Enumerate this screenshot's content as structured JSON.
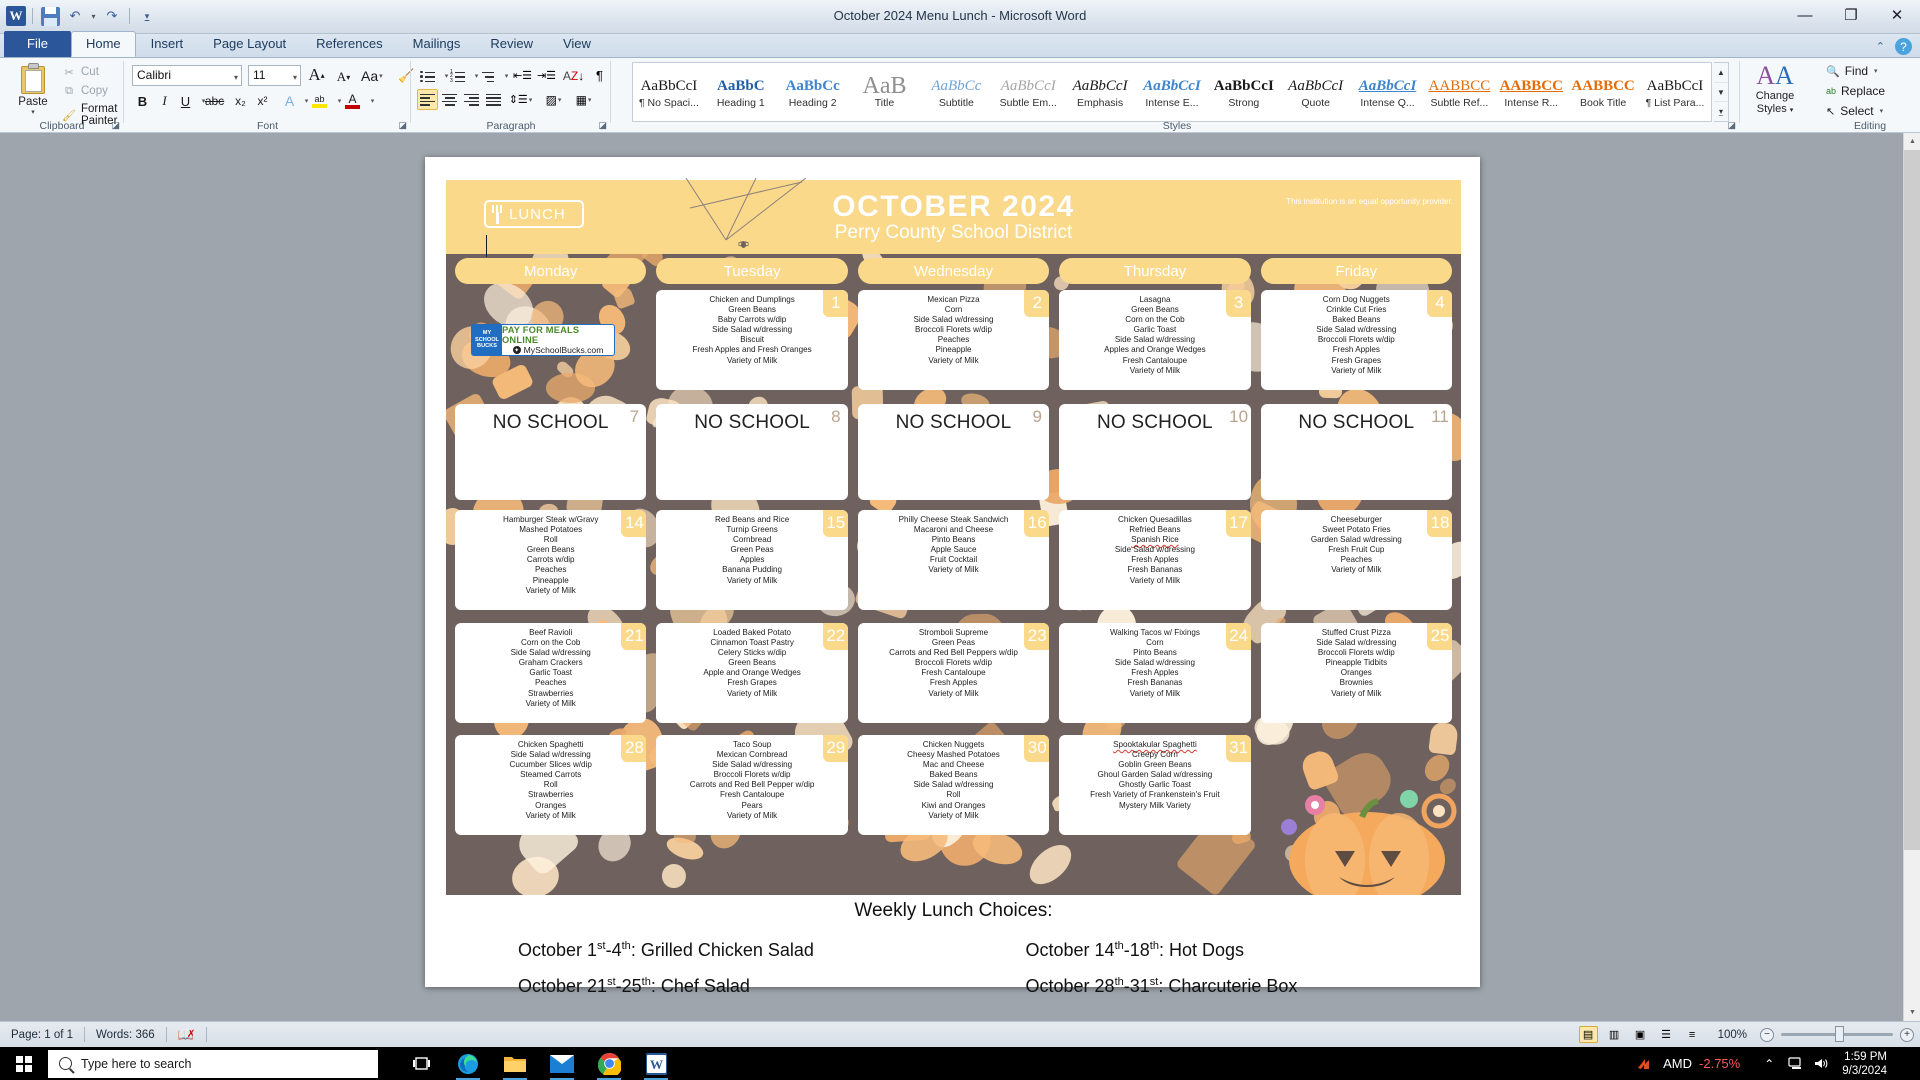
{
  "window": {
    "title": "October 2024 Menu Lunch  -  Microsoft Word",
    "minimize": "—",
    "restore": "❐",
    "close": "✕",
    "ribbon_collapse": "⌃",
    "help": "?"
  },
  "qat": {
    "word_logo": "W",
    "save": "save-icon",
    "undo": "↶",
    "redo": "↷",
    "customize": "☰"
  },
  "tabs": [
    {
      "label": "File",
      "active": false,
      "file": true
    },
    {
      "label": "Home",
      "active": true
    },
    {
      "label": "Insert",
      "active": false
    },
    {
      "label": "Page Layout",
      "active": false
    },
    {
      "label": "References",
      "active": false
    },
    {
      "label": "Mailings",
      "active": false
    },
    {
      "label": "Review",
      "active": false
    },
    {
      "label": "View",
      "active": false
    }
  ],
  "ribbon": {
    "clipboard": {
      "group_label": "Clipboard",
      "paste": "Paste",
      "cut": "Cut",
      "copy": "Copy",
      "format_painter": "Format Painter"
    },
    "font": {
      "group_label": "Font",
      "font_name": "Calibri",
      "font_size": "11",
      "grow": "A",
      "shrink": "A",
      "change_case": "Aa",
      "clear_formatting": "clear-formatting-icon",
      "bold": "B",
      "italic": "I",
      "underline": "U",
      "strikethrough": "abc",
      "subscript": "x₂",
      "superscript": "x²",
      "text_effects": "A",
      "highlight": "ab",
      "font_color": "A"
    },
    "paragraph": {
      "group_label": "Paragraph",
      "bullets": "bullets-icon",
      "numbering": "numbering-icon",
      "multilevel": "multilevel-list-icon",
      "decrease_indent": "decrease-indent-icon",
      "increase_indent": "increase-indent-icon",
      "sort": "sort-icon",
      "show_marks": "¶",
      "align_left": "align-left-icon",
      "align_center": "align-center-icon",
      "align_right": "align-right-icon",
      "justify": "justify-icon",
      "line_spacing": "line-spacing-icon",
      "shading": "shading-icon",
      "borders": "borders-icon"
    },
    "styles": {
      "group_label": "Styles",
      "change_styles": "Change Styles",
      "items": [
        {
          "preview": "AaBbCcI",
          "name": "¶ No Spaci...",
          "color": "#1a1a1a",
          "style": "normal",
          "weight": "normal"
        },
        {
          "preview": "AaBbC",
          "name": "Heading 1",
          "color": "#1f5fa8",
          "style": "normal",
          "weight": "bold"
        },
        {
          "preview": "AaBbCc",
          "name": "Heading 2",
          "color": "#3d85cc",
          "style": "normal",
          "weight": "bold"
        },
        {
          "preview": "AaB",
          "name": "Title",
          "color": "#8f8f8f",
          "style": "normal",
          "weight": "normal",
          "big": true
        },
        {
          "preview": "AaBbCc",
          "name": "Subtitle",
          "color": "#6fa3d8",
          "style": "italic",
          "weight": "normal"
        },
        {
          "preview": "AaBbCcI",
          "name": "Subtle Em...",
          "color": "#a6a6a6",
          "style": "italic",
          "weight": "normal"
        },
        {
          "preview": "AaBbCcI",
          "name": "Emphasis",
          "color": "#1a1a1a",
          "style": "italic",
          "weight": "normal"
        },
        {
          "preview": "AaBbCcI",
          "name": "Intense E...",
          "color": "#3d85cc",
          "style": "italic",
          "weight": "bold"
        },
        {
          "preview": "AaBbCcI",
          "name": "Strong",
          "color": "#1a1a1a",
          "style": "normal",
          "weight": "bold"
        },
        {
          "preview": "AaBbCcI",
          "name": "Quote",
          "color": "#1a1a1a",
          "style": "italic",
          "weight": "normal"
        },
        {
          "preview": "AaBbCcI",
          "name": "Intense Q...",
          "color": "#3d85cc",
          "style": "italic",
          "weight": "bold",
          "underline": true
        },
        {
          "preview": "AABBCC",
          "name": "Subtle Ref...",
          "color": "#e36c09",
          "style": "normal",
          "weight": "normal",
          "underline": true
        },
        {
          "preview": "AABBCC",
          "name": "Intense R...",
          "color": "#e36c09",
          "style": "normal",
          "weight": "bold",
          "underline": true
        },
        {
          "preview": "AABBCC",
          "name": "Book Title",
          "color": "#e36c09",
          "style": "normal",
          "weight": "bold"
        },
        {
          "preview": "AaBbCcI",
          "name": "¶ List Para...",
          "color": "#1a1a1a",
          "style": "normal",
          "weight": "normal"
        }
      ]
    },
    "editing": {
      "group_label": "Editing",
      "find": "Find",
      "replace": "Replace",
      "select": "Select"
    }
  },
  "document": {
    "calendar": {
      "badge": "LUNCH",
      "title": "OCTOBER  2024",
      "subtitle": "Perry County School District",
      "equal_opportunity": "This institution is an equal opportunity provider.",
      "myschoolbucks": {
        "brand_line1": "MY",
        "brand_line2": "SCHOOL",
        "brand_line3": "BUCKS",
        "headline": "PAY FOR MEALS ONLINE",
        "url": "MySchoolBucks.com"
      },
      "day_headers": [
        "Monday",
        "Tuesday",
        "Wednesday",
        "Thursday",
        "Friday"
      ],
      "no_school_label": "NO SCHOOL",
      "weeks": [
        {
          "cells": [
            {
              "type": "promo"
            },
            {
              "type": "menu",
              "date": "1",
              "items": [
                "Chicken and Dumplings",
                "Green Beans",
                "Baby Carrots w/dip",
                "Side Salad w/dressing",
                "Biscuit",
                "Fresh Apples and Fresh Oranges",
                "Variety of Milk"
              ]
            },
            {
              "type": "menu",
              "date": "2",
              "items": [
                "Mexican Pizza",
                "Corn",
                "Side Salad w/dressing",
                "Broccoli Florets w/dip",
                "Peaches",
                "Pineapple",
                "Variety of Milk"
              ]
            },
            {
              "type": "menu",
              "date": "3",
              "items": [
                "Lasagna",
                "Green Beans",
                "Corn on the Cob",
                "Garlic Toast",
                "Side Salad w/dressing",
                "Apples and Orange Wedges",
                "Fresh Cantaloupe",
                "Variety of Milk"
              ]
            },
            {
              "type": "menu",
              "date": "4",
              "items": [
                "Corn Dog Nuggets",
                "Crinkle Cut Fries",
                "Baked Beans",
                "Side Salad w/dressing",
                "Broccoli Florets w/dip",
                "Fresh Apples",
                "Fresh Grapes",
                "Variety of Milk"
              ]
            }
          ]
        },
        {
          "cells": [
            {
              "type": "noschool",
              "date": "7"
            },
            {
              "type": "noschool",
              "date": "8"
            },
            {
              "type": "noschool",
              "date": "9"
            },
            {
              "type": "noschool",
              "date": "10"
            },
            {
              "type": "noschool",
              "date": "11"
            }
          ]
        },
        {
          "cells": [
            {
              "type": "menu",
              "date": "14",
              "items": [
                "Hamburger Steak w/Gravy",
                "Mashed Potatoes",
                "Roll",
                "Green Beans",
                "Carrots w/dip",
                "Peaches",
                "Pineapple",
                "Variety of Milk"
              ]
            },
            {
              "type": "menu",
              "date": "15",
              "items": [
                "Red Beans and Rice",
                "Turnip Greens",
                "Cornbread",
                "Green Peas",
                "Apples",
                "Banana Pudding",
                "Variety of Milk"
              ]
            },
            {
              "type": "menu",
              "date": "16",
              "items": [
                "Philly Cheese Steak Sandwich",
                "Macaroni and Cheese",
                "Pinto Beans",
                "Apple Sauce",
                "Fruit Cocktail",
                "Variety of Milk"
              ]
            },
            {
              "type": "menu",
              "date": "17",
              "items": [
                "Chicken Quesadillas",
                "Refried Beans",
                "Spanish Rice",
                "Side Salad w/dressing",
                "Fresh Apples",
                "Fresh Bananas",
                "Variety of Milk"
              ],
              "spell_errors": [
                2
              ]
            },
            {
              "type": "menu",
              "date": "18",
              "items": [
                "Cheeseburger",
                "Sweet Potato Fries",
                "Garden Salad w/dressing",
                "Fresh Fruit Cup",
                "Peaches",
                "Variety of Milk"
              ]
            }
          ]
        },
        {
          "cells": [
            {
              "type": "menu",
              "date": "21",
              "items": [
                "Beef Ravioli",
                "Corn on the Cob",
                "Side Salad w/dressing",
                "Graham Crackers",
                "Garlic Toast",
                "Peaches",
                "Strawberries",
                "Variety of Milk"
              ]
            },
            {
              "type": "menu",
              "date": "22",
              "items": [
                "Loaded Baked Potato",
                "Cinnamon Toast Pastry",
                "Celery Sticks w/dip",
                "Green Beans",
                "Apple and Orange Wedges",
                "Fresh Grapes",
                "Variety of Milk"
              ]
            },
            {
              "type": "menu",
              "date": "23",
              "items": [
                "Stromboli Supreme",
                "Green Peas",
                "Carrots and Red Bell Peppers w/dip",
                "Broccoli Florets w/dip",
                "Fresh Cantaloupe",
                "Fresh Apples",
                "Variety of Milk"
              ]
            },
            {
              "type": "menu",
              "date": "24",
              "items": [
                "Walking Tacos w/ Fixings",
                "Corn",
                "Pinto Beans",
                "Side Salad w/dressing",
                "Fresh Apples",
                "Fresh Bananas",
                "Variety of Milk"
              ]
            },
            {
              "type": "menu",
              "date": "25",
              "items": [
                "Stuffed Crust Pizza",
                "Side Salad w/dressing",
                "Broccoli Florets w/dip",
                "Pineapple Tidbits",
                "Oranges",
                "Brownies",
                "Variety of Milk"
              ]
            }
          ]
        },
        {
          "cells": [
            {
              "type": "menu",
              "date": "28",
              "items": [
                "Chicken Spaghetti",
                "Side Salad w/dressing",
                "Cucumber Slices w/dip",
                "Steamed Carrots",
                "Roll",
                "Strawberries",
                "Oranges",
                "Variety of Milk"
              ]
            },
            {
              "type": "menu",
              "date": "29",
              "items": [
                "Taco Soup",
                "Mexican Cornbread",
                "Side Salad w/dressing",
                "Broccoli Florets w/dip",
                "Carrots and Red Bell Pepper w/dip",
                "Fresh Cantaloupe",
                "Pears",
                "Variety of Milk"
              ]
            },
            {
              "type": "menu",
              "date": "30",
              "items": [
                "Chicken Nuggets",
                "Cheesy Mashed Potatoes",
                "Mac and Cheese",
                "Baked Beans",
                "Side Salad w/dressing",
                "Roll",
                "Kiwi and Oranges",
                "Variety of Milk"
              ]
            },
            {
              "type": "menu",
              "date": "31",
              "items": [
                "Spooktakular Spaghetti",
                "Creepy Corn",
                "Goblin Green Beans",
                "Ghoul Garden Salad w/dressing",
                "Ghostly Garlic Toast",
                "Fresh Variety of Frankenstein's Fruit",
                "Mystery Milk Variety"
              ],
              "spell_errors": [
                0
              ]
            },
            {
              "type": "empty"
            }
          ]
        }
      ],
      "choices_title": "Weekly Lunch Choices:",
      "choices": [
        {
          "prefix": "October 1",
          "sup1": "st",
          "mid": "-4",
          "sup2": "th",
          "suffix": ": Grilled Chicken Salad"
        },
        {
          "prefix": "October 14",
          "sup1": "th",
          "mid": "-18",
          "sup2": "th",
          "suffix": ": Hot Dogs"
        },
        {
          "prefix": "October 21",
          "sup1": "st",
          "mid": "-25",
          "sup2": "th",
          "suffix": ": Chef Salad"
        },
        {
          "prefix": "October 28",
          "sup1": "th",
          "mid": "-31",
          "sup2": "st",
          "suffix": ": Charcuterie Box"
        }
      ]
    }
  },
  "statusbar": {
    "page": "Page: 1 of 1",
    "words": "Words: 366",
    "proofing": "proofing-errors-icon",
    "zoom": "100%",
    "views": [
      "print-layout-view",
      "full-screen-reading-view",
      "web-layout-view",
      "outline-view",
      "draft-view"
    ],
    "zoom_out": "−",
    "zoom_in": "+"
  },
  "taskbar": {
    "search_placeholder": "Type here to search",
    "start": "start-button",
    "task_view": "task-view-icon",
    "apps": [
      "edge-icon",
      "file-explorer-icon",
      "mail-icon",
      "chrome-icon",
      "word-icon"
    ],
    "amd_label": "AMD",
    "amd_change": "-2.75%",
    "time": "1:59 PM",
    "date": "9/3/2024",
    "show_hidden": "⌃",
    "network": "network-icon",
    "volume": "volume-icon"
  },
  "colors": {
    "accent_yellow": "#fbd98b",
    "calendar_bg": "#6f625e",
    "word_blue": "#2b579a",
    "amd_red": "#ff5a5a"
  }
}
